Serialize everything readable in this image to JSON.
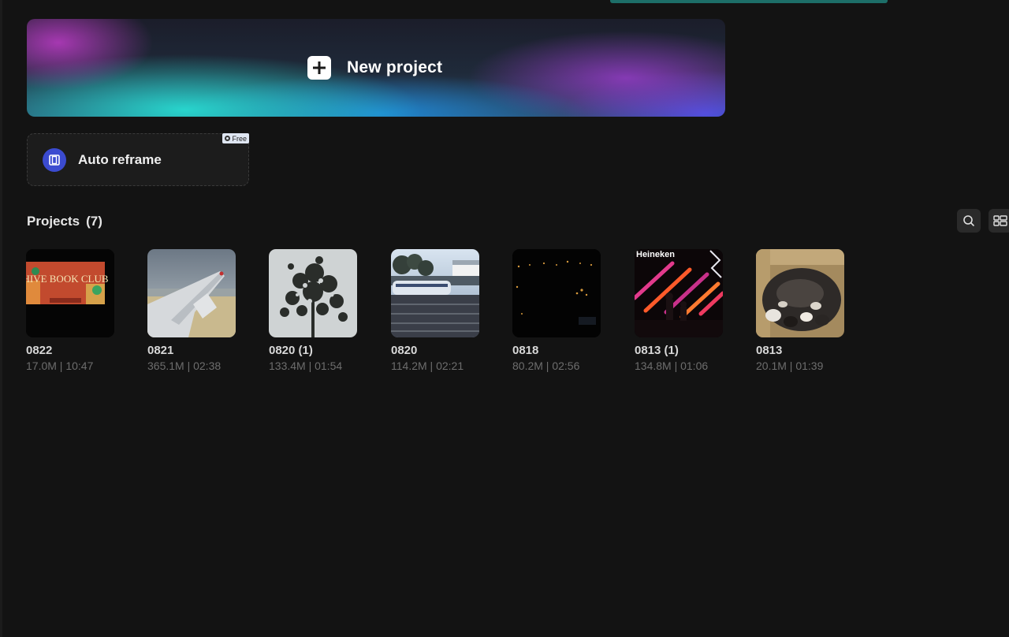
{
  "new_project": {
    "label": "New project"
  },
  "auto_reframe": {
    "label": "Auto reframe",
    "badge": "Free"
  },
  "projects": {
    "title": "Projects",
    "count": "(7)",
    "items": [
      {
        "name": "0822",
        "meta": "17.0M | 10:47"
      },
      {
        "name": "0821",
        "meta": "365.1M | 02:38"
      },
      {
        "name": "0820 (1)",
        "meta": "133.4M | 01:54"
      },
      {
        "name": "0820",
        "meta": "114.2M | 02:21"
      },
      {
        "name": "0818",
        "meta": "80.2M | 02:56"
      },
      {
        "name": "0813 (1)",
        "meta": "134.8M | 01:06"
      },
      {
        "name": "0813",
        "meta": "20.1M | 01:39"
      }
    ]
  },
  "thumb_text": {
    "book_club": "HIVE BOOK CLUB",
    "heineken": "Heineken"
  },
  "icons": {
    "search": "search-icon",
    "view": "grid-view-icon",
    "plus": "plus-icon",
    "reframe": "reframe-icon"
  },
  "colors": {
    "background": "#131313",
    "accent_reframe": "#3b4bd0"
  }
}
